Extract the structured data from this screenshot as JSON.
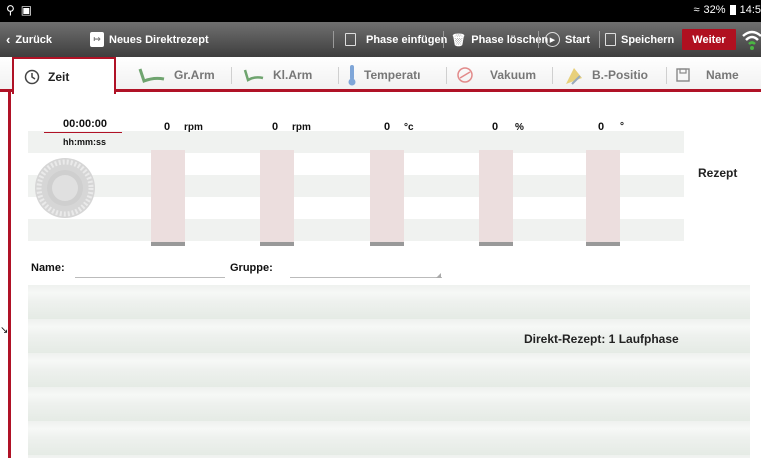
{
  "statusbar": {
    "battery": "32%",
    "time": "14:5"
  },
  "actionbar": {
    "back_label": "Zurück",
    "title": "Neues Direktrezept",
    "phase_insert": "Phase einfügen",
    "phase_delete": "Phase löschen",
    "start": "Start",
    "save": "Speichern",
    "next": "Weiter"
  },
  "tabs": [
    {
      "label": "Zeit",
      "icon": "clock-icon"
    },
    {
      "label": "Gr.Arm",
      "icon": "large-arm-icon"
    },
    {
      "label": "Kl.Arm",
      "icon": "small-arm-icon"
    },
    {
      "label": "Temperatı",
      "icon": "thermometer-icon"
    },
    {
      "label": "Vakuum",
      "icon": "vacuum-icon"
    },
    {
      "label": "B.-Positio",
      "icon": "position-icon"
    },
    {
      "label": "Name",
      "icon": "save-icon"
    }
  ],
  "readouts": {
    "time": "00:00:00",
    "time_format": "hh:mm:ss",
    "large_arm": {
      "value": "0",
      "unit": "rpm"
    },
    "small_arm": {
      "value": "0",
      "unit": "rpm"
    },
    "temperature": {
      "value": "0",
      "unit": "°c"
    },
    "vacuum": {
      "value": "0",
      "unit": "%"
    },
    "position": {
      "value": "0",
      "unit": "°"
    }
  },
  "rezept_label": "Rezept",
  "form": {
    "name_label": "Name:",
    "name_value": "",
    "group_label": "Gruppe:",
    "group_value": ""
  },
  "phase_list": {
    "summary": "Direkt-Rezept: 1 Laufphase"
  },
  "colors": {
    "accent": "#b01226",
    "actionbar": "#555555",
    "bar_fill": "#ecdede"
  }
}
